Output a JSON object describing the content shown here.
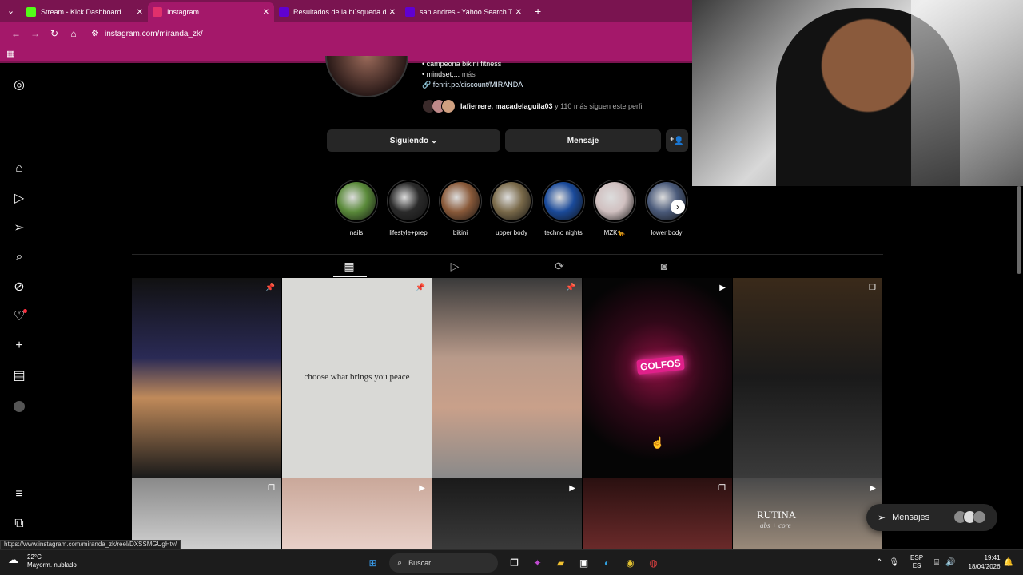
{
  "browser": {
    "tabs": [
      {
        "title": "Stream - Kick Dashboard",
        "favicon": "kick-icon",
        "color": "#53fc18",
        "active": false
      },
      {
        "title": "Instagram",
        "favicon": "instagram-icon",
        "color": "#e1306c",
        "active": true
      },
      {
        "title": "Resultados de la búsqueda de",
        "favicon": "yahoo-icon",
        "color": "#6001d2",
        "active": false
      },
      {
        "title": "san andres - Yahoo Search Tus",
        "favicon": "yahoo-icon",
        "color": "#6001d2",
        "active": false
      }
    ],
    "url": "instagram.com/miranda_zk/",
    "status_url": "https://www.instagram.com/miranda_zk/reel/DXSSMGUgHtv/"
  },
  "profile": {
    "bio_line1": "• campeona bikini fitness",
    "bio_line2": "• mindset,...",
    "bio_more": "más",
    "bio_link": "fenrir.pe/discount/MIRANDA",
    "followed_by_names": "lafierrere, macadelaguila03",
    "followed_by_rest": " y 110 más siguen este perfil",
    "following_button": "Siguiendo",
    "message_button": "Mensaje"
  },
  "highlights": [
    {
      "label": "nails",
      "color": "#5a8a3a"
    },
    {
      "label": "lifestyle+prep",
      "color": "#2a2a2a"
    },
    {
      "label": "bikini",
      "color": "#8a5a3a"
    },
    {
      "label": "upper body",
      "color": "#7a6a4a"
    },
    {
      "label": "techno nights",
      "color": "#1a4a9a"
    },
    {
      "label": "MZK🐆",
      "color": "#d0c0c0"
    },
    {
      "label": "lower body",
      "color": "#4a5a7a"
    }
  ],
  "posts": [
    {
      "badge": "pin-icon",
      "bg": "linear-gradient(180deg,#111 0%,#2a2a55 40%,#c08a5a 60%,#1a1a1a 100%)"
    },
    {
      "badge": "pin-icon",
      "bg": "#d9d9d6",
      "text": "choose what brings you peace"
    },
    {
      "badge": "pin-icon",
      "bg": "linear-gradient(180deg,#3a3a3a 0%,#b89a8a 40%,#c9a08a 65%,#8a8a8a 100%)"
    },
    {
      "badge": "reel-icon",
      "bg": "radial-gradient(circle at 50% 45%,#8a1040 0%,#300818 35%,#050505 70%)",
      "neon": "GOLFOS"
    },
    {
      "badge": "carousel-icon",
      "bg": "linear-gradient(180deg,#3a2a1a 0%,#1a1a1a 50%,#3a3a3a 100%)"
    },
    {
      "badge": "carousel-icon",
      "bg": "linear-gradient(180deg,#8a8a8a,#d0d0d0)"
    },
    {
      "badge": "reel-icon",
      "bg": "linear-gradient(180deg,#caa89a,#e8d0c8)"
    },
    {
      "badge": "reel-icon",
      "bg": "linear-gradient(180deg,#1a1a1a,#3a3a3a)"
    },
    {
      "badge": "carousel-icon",
      "bg": "linear-gradient(180deg,#2a1010,#6a2a2a)"
    },
    {
      "badge": "reel-icon",
      "bg": "linear-gradient(180deg,#4a4a4a,#9a8a7a)",
      "rutina": "RUTINA",
      "rutina_sub": "abs + core"
    }
  ],
  "messages_pill": {
    "label": "Mensajes"
  },
  "taskbar": {
    "temp": "22°C",
    "weather": "Mayorm. nublado",
    "search": "Buscar",
    "lang1": "ESP",
    "lang2": "ES",
    "time": "19:41",
    "date": "18/04/2026"
  }
}
